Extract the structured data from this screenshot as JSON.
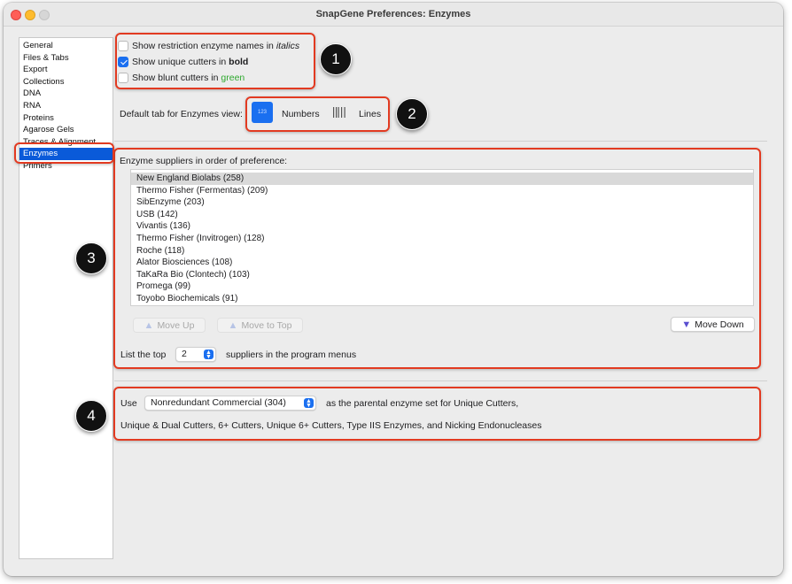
{
  "window": {
    "title": "SnapGene Preferences:  Enzymes"
  },
  "sidebar": {
    "items": [
      {
        "label": "General",
        "selected": false
      },
      {
        "label": "Files & Tabs",
        "selected": false
      },
      {
        "label": "Export",
        "selected": false
      },
      {
        "label": "Collections",
        "selected": false
      },
      {
        "label": "DNA",
        "selected": false
      },
      {
        "label": "RNA",
        "selected": false
      },
      {
        "label": "Proteins",
        "selected": false
      },
      {
        "label": "Agarose Gels",
        "selected": false
      },
      {
        "label": "Traces & Alignment",
        "selected": false
      },
      {
        "label": "Enzymes",
        "selected": true
      },
      {
        "label": "Primers",
        "selected": false
      }
    ]
  },
  "options": {
    "italics": {
      "label": "Show restriction enzyme names in ",
      "emph": "italics",
      "checked": false
    },
    "bold": {
      "label": "Show unique cutters in ",
      "emph": "bold",
      "checked": true
    },
    "green": {
      "label": "Show blunt cutters in ",
      "emph": "green",
      "checked": false
    }
  },
  "default_tab": {
    "label": "Default tab for Enzymes view:",
    "numbers_icon_text": "123",
    "numbers_label": "Numbers",
    "lines_label": "Lines",
    "selected": "Numbers"
  },
  "suppliers": {
    "heading": "Enzyme suppliers in order of preference:",
    "items": [
      "New England Biolabs (258)",
      "Thermo Fisher (Fermentas) (209)",
      "SibEnzyme (203)",
      "USB (142)",
      "Vivantis (136)",
      "Thermo Fisher (Invitrogen) (128)",
      "Roche (118)",
      "Alator Biosciences (108)",
      "TaKaRa Bio (Clontech) (103)",
      "Promega (99)",
      "Toyobo Biochemicals (91)"
    ],
    "selected_index": 0,
    "move_up_label": "Move Up",
    "move_to_top_label": "Move to Top",
    "move_down_label": "Move Down",
    "list_top_prefix": "List the top",
    "list_top_value": "2",
    "list_top_suffix": "suppliers in the program menus"
  },
  "parental": {
    "use_label": "Use",
    "selected_set": "Nonredundant Commercial  (304)",
    "suffix": "as the parental enzyme set for Unique Cutters,",
    "line2": "Unique & Dual Cutters, 6+ Cutters, Unique 6+ Cutters, Type IIS Enzymes, and Nicking Endonucleases"
  },
  "annotations": {
    "badges": [
      "1",
      "2",
      "3",
      "4"
    ],
    "color": "#e23a21"
  },
  "colors": {
    "accent": "#1a6ff0",
    "sidebar_selected": "#0a5ad9",
    "green_text": "#2ea82e"
  }
}
